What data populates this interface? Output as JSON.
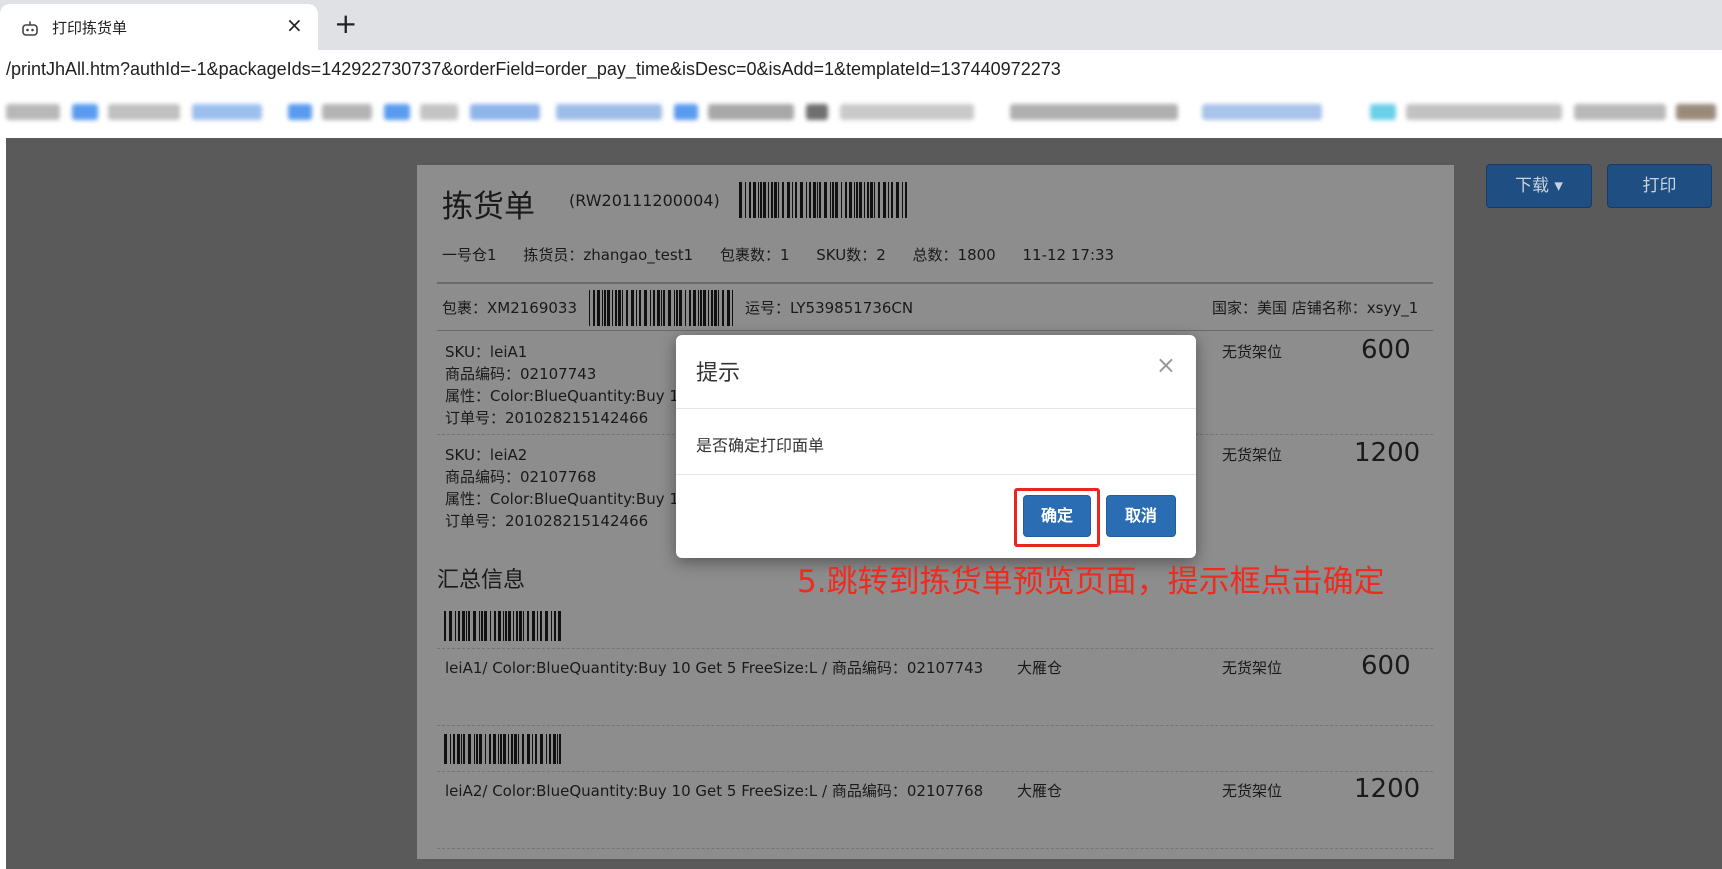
{
  "browser": {
    "tab_title": "打印拣货单",
    "tab_close": "×",
    "new_tab": "+",
    "url": "/printJhAll.htm?authId=-1&packageIds=142922730737&orderField=order_pay_time&isDesc=0&isAdd=1&templateId=137440972273"
  },
  "toolbar": {
    "download_label": "下载 ▾",
    "print_label": "打印"
  },
  "sheet": {
    "title": "拣货单",
    "code": "(RW20111200004)",
    "meta": {
      "warehouse": "一号仓1",
      "picker": "拣货员：zhangao_test1",
      "packages": "包裹数：1",
      "sku_count": "SKU数：2",
      "total": "总数：1800",
      "time": "11-12 17:33"
    },
    "package": {
      "id": "包裹：XM2169033",
      "tracking": "运号：LY539851736CN",
      "country_shop": "国家：美国  店铺名称：xsyy_1"
    },
    "items": [
      {
        "sku": "SKU：leiA1",
        "code": "商品编码：02107743",
        "attr": "属性：Color:BlueQuantity:Buy 1",
        "order": "订单号：201028215142466",
        "shelf": "无货架位",
        "qty": "600"
      },
      {
        "sku": "SKU：leiA2",
        "code": "商品编码：02107768",
        "attr": "属性：Color:BlueQuantity:Buy 1",
        "order": "订单号：201028215142466",
        "shelf": "无货架位",
        "qty": "1200"
      }
    ],
    "summary_title": "汇总信息",
    "summary": [
      {
        "desc": "leiA1/ Color:BlueQuantity:Buy 10 Get 5 FreeSize:L / 商品编码：02107743",
        "warehouse": "大雁仓",
        "shelf": "无货架位",
        "qty": "600"
      },
      {
        "desc": "leiA2/ Color:BlueQuantity:Buy 10 Get 5 FreeSize:L / 商品编码：02107768",
        "warehouse": "大雁仓",
        "shelf": "无货架位",
        "qty": "1200"
      }
    ]
  },
  "modal": {
    "title": "提示",
    "close": "×",
    "message": "是否确定打印面单",
    "confirm_label": "确定",
    "cancel_label": "取消"
  },
  "annotation": "5.跳转到拣货单预览页面，提示框点击确定",
  "colors": {
    "primary_button": "#2a6db3",
    "annotation": "#ef2b1f",
    "overlay": "#5a5a5a"
  }
}
